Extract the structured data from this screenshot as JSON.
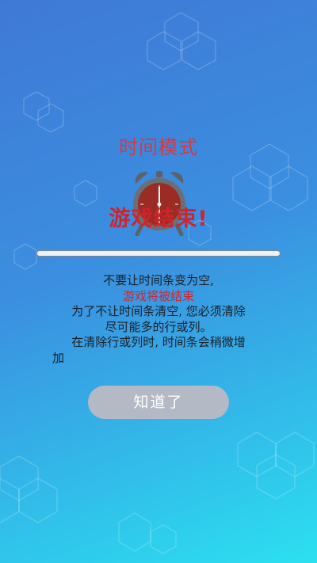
{
  "dialog": {
    "mode_title": "时间模式",
    "game_over": "游戏结束!",
    "time_bar": {
      "level": 0.98
    },
    "instructions": [
      "不要让时间条变为空,",
      "游戏将被结束",
      "为了不让时间条清空, 您必须清除",
      "尽可能多的行或列。",
      "在清除行或列时, 时间条会稍微增",
      "加"
    ],
    "ok_button_label": "知道了"
  },
  "icons": {
    "clock": "alarm-clock-icon"
  },
  "colors": {
    "title_red": "#d9383e",
    "highlight_red": "#d0242c",
    "clock_face": "#9b2b25",
    "clock_frame": "#6b6f73",
    "button_gray": "#b3bac6",
    "background_top": "#3f79d6",
    "background_bottom": "#2ce0f0"
  }
}
